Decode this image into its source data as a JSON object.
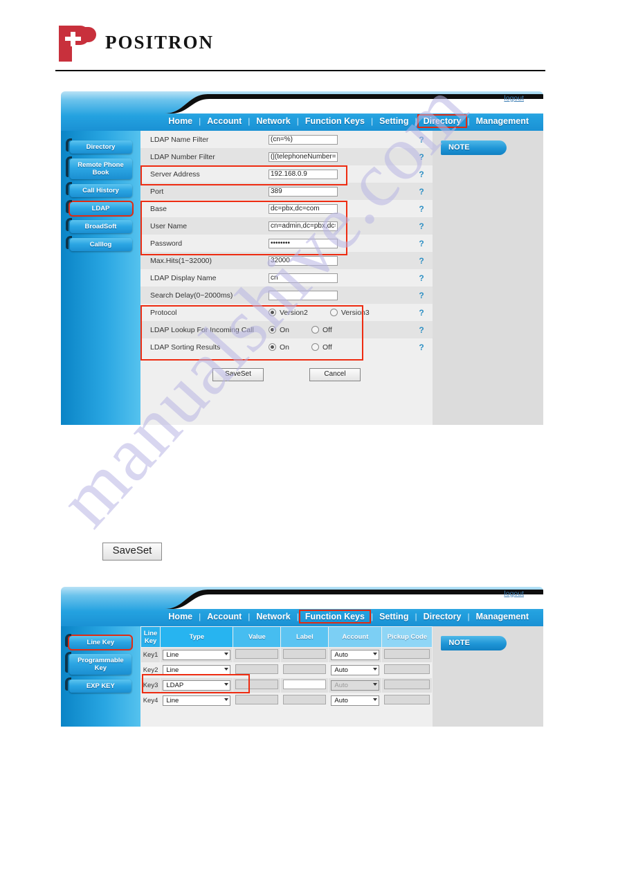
{
  "brand": {
    "name": "POSITRON"
  },
  "watermark": {
    "text": "manualshive.com"
  },
  "panel1": {
    "logout_label": "logout",
    "nav": [
      {
        "label": "Home",
        "highlighted": false
      },
      {
        "label": "Account",
        "highlighted": false
      },
      {
        "label": "Network",
        "highlighted": false
      },
      {
        "label": "Function Keys",
        "highlighted": false
      },
      {
        "label": "Setting",
        "highlighted": false
      },
      {
        "label": "Directory",
        "highlighted": true
      },
      {
        "label": "Management",
        "highlighted": false
      }
    ],
    "sidebar": [
      {
        "label": "Directory",
        "selected": false
      },
      {
        "label": "Remote Phone Book",
        "selected": false
      },
      {
        "label": "Call History",
        "selected": false
      },
      {
        "label": "LDAP",
        "selected": true
      },
      {
        "label": "BroadSoft",
        "selected": false
      },
      {
        "label": "Calllog",
        "selected": false
      }
    ],
    "note_label": "NOTE",
    "fields": [
      {
        "label": "LDAP Name Filter",
        "value": "(cn=%)",
        "help": "?"
      },
      {
        "label": "LDAP Number Filter",
        "value": "(|(telephoneNumber=%)(",
        "help": "?"
      },
      {
        "label": "Server Address",
        "value": "192.168.0.9",
        "help": "?"
      },
      {
        "label": "Port",
        "value": "389",
        "help": "?"
      },
      {
        "label": "Base",
        "value": "dc=pbx,dc=com",
        "help": "?"
      },
      {
        "label": "User Name",
        "value": "cn=admin,dc=pbx,dc=co",
        "help": "?"
      },
      {
        "label": "Password",
        "value": "••••••••",
        "help": "?"
      },
      {
        "label": "Max.Hits(1~32000)",
        "value": "32000",
        "help": "?"
      },
      {
        "label": "LDAP Display Name",
        "value": "cn",
        "help": "?"
      },
      {
        "label": "Search Delay(0~2000ms)",
        "value": "",
        "help": "?"
      }
    ],
    "radio_rows": [
      {
        "label": "Protocol",
        "opt1": "Version2",
        "opt2": "Version3",
        "selected": 1,
        "help": "?"
      },
      {
        "label": "LDAP Lookup For Incoming Call",
        "opt1": "On",
        "opt2": "Off",
        "selected": 1,
        "help": "?"
      },
      {
        "label": "LDAP Sorting Results",
        "opt1": "On",
        "opt2": "Off",
        "selected": 1,
        "help": "?"
      }
    ],
    "buttons": {
      "save": "SaveSet",
      "cancel": "Cancel"
    }
  },
  "standalone_button": {
    "label": "SaveSet"
  },
  "panel2": {
    "logout_label": "logout",
    "nav": [
      {
        "label": "Home",
        "highlighted": false
      },
      {
        "label": "Account",
        "highlighted": false
      },
      {
        "label": "Network",
        "highlighted": false
      },
      {
        "label": "Function Keys",
        "highlighted": true
      },
      {
        "label": "Setting",
        "highlighted": false
      },
      {
        "label": "Directory",
        "highlighted": false
      },
      {
        "label": "Management",
        "highlighted": false
      }
    ],
    "sidebar": [
      {
        "label": "Line Key",
        "selected": true
      },
      {
        "label": "Programmable Key",
        "selected": false
      },
      {
        "label": "EXP KEY",
        "selected": false
      }
    ],
    "note_label": "NOTE",
    "table": {
      "headers": [
        "Line Key",
        "Type",
        "Value",
        "Label",
        "Account",
        "Pickup Code"
      ],
      "rows": [
        {
          "key": "Key1",
          "type": "Line",
          "value": "",
          "label": "",
          "account": "Auto",
          "pickup": "",
          "highlighted": false
        },
        {
          "key": "Key2",
          "type": "Line",
          "value": "",
          "label": "",
          "account": "Auto",
          "pickup": "",
          "highlighted": false
        },
        {
          "key": "Key3",
          "type": "LDAP",
          "value": "",
          "label": "",
          "account": "Auto",
          "pickup": "",
          "highlighted": true
        },
        {
          "key": "Key4",
          "type": "Line",
          "value": "",
          "label": "",
          "account": "Auto",
          "pickup": "",
          "highlighted": false
        }
      ]
    }
  },
  "colors": {
    "brand_red": "#c8303c",
    "highlight_red": "#ee2b10",
    "nav_blue": "#24a2e0",
    "header_blue": "#29a6e2"
  }
}
